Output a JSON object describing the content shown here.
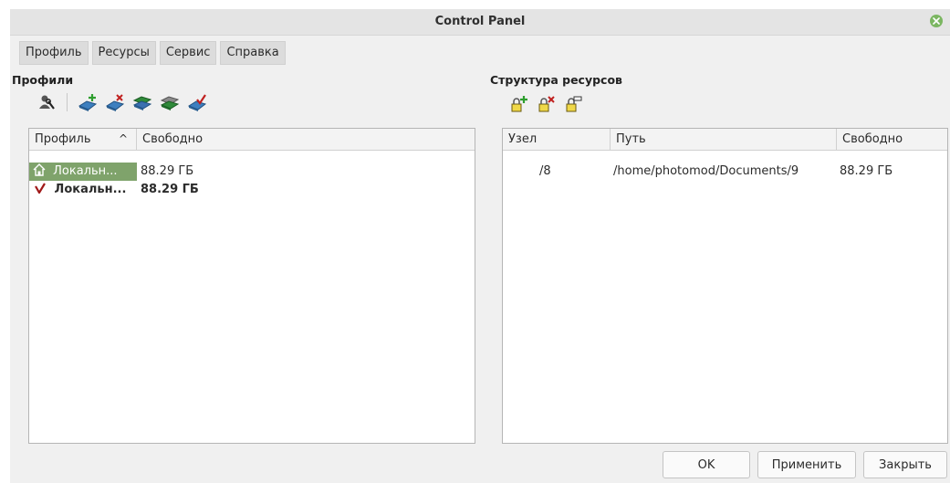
{
  "window": {
    "title": "Control Panel"
  },
  "menu": [
    "Профиль",
    "Ресурсы",
    "Сервис",
    "Справка"
  ],
  "profiles": {
    "title": "Профили",
    "toolbar_icons": [
      "profile-settings-icon",
      "add-profile-icon",
      "remove-profile-icon",
      "copy-profile-icon",
      "stack-profile-icon",
      "activate-profile-icon"
    ],
    "columns": [
      "Профиль",
      "Свободно"
    ],
    "sort_indicator": "^",
    "rows": [
      {
        "name": "Локальн...",
        "free": "88.29 ГБ",
        "icon": "home-icon",
        "selected": true,
        "bold": false
      },
      {
        "name": "Локальн...",
        "free": "88.29 ГБ",
        "icon": "check-icon",
        "selected": false,
        "bold": true
      }
    ]
  },
  "resources": {
    "title": "Структура ресурсов",
    "toolbar_icons": [
      "add-resource-icon",
      "remove-resource-icon",
      "edit-resource-icon"
    ],
    "columns": [
      "Узел",
      "Путь",
      "Свободно"
    ],
    "rows": [
      {
        "node": "/8",
        "path": "/home/photomod/Documents/9",
        "free": "88.29 ГБ"
      }
    ]
  },
  "buttons": {
    "ok": "OK",
    "apply": "Применить",
    "close": "Закрыть"
  },
  "colors": {
    "selection": "#7fa36b",
    "check": "#a01818",
    "close_button": "#7bb661"
  }
}
